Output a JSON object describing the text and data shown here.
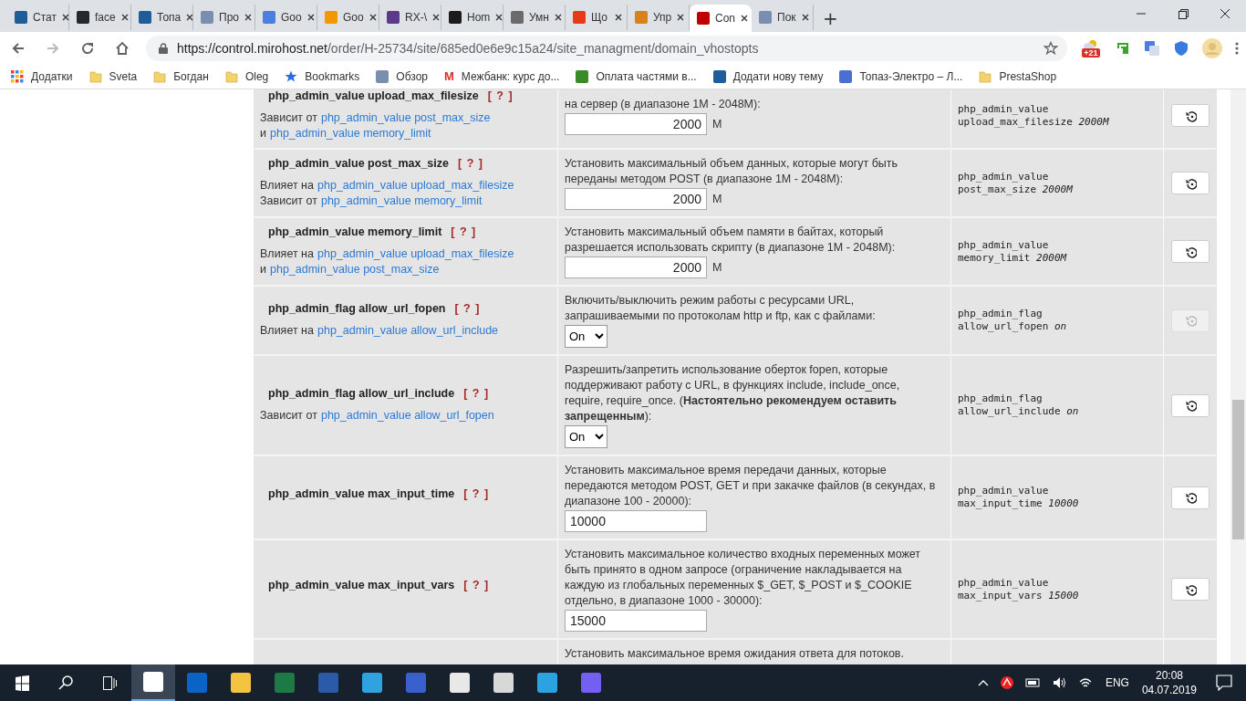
{
  "browser": {
    "tabs": [
      {
        "title": "Стат",
        "color": "#1f5c99",
        "selected": false
      },
      {
        "title": "face",
        "color": "#24292e",
        "selected": false
      },
      {
        "title": "Топа",
        "color": "#1f5c99",
        "selected": false
      },
      {
        "title": "Про",
        "color": "#7a8fb0",
        "selected": false
      },
      {
        "title": "Goo",
        "color": "#4a7fe0",
        "selected": false
      },
      {
        "title": "Goo",
        "color": "#f29900",
        "selected": false
      },
      {
        "title": "RX-\\",
        "color": "#5b3a8a",
        "selected": false
      },
      {
        "title": "Hom",
        "color": "#1b1b1b",
        "selected": false
      },
      {
        "title": "Умн",
        "color": "#6b6b6b",
        "selected": false
      },
      {
        "title": "Що",
        "color": "#e8391b",
        "selected": false
      },
      {
        "title": "Упр",
        "color": "#d9821b",
        "selected": false
      },
      {
        "title": "Con",
        "color": "#c00000",
        "selected": true
      },
      {
        "title": "Пок",
        "color": "#7a8fb0",
        "selected": false
      }
    ],
    "new_tab": "+",
    "url_host": "https://control.mirohost.net",
    "url_path": "/order/H-25734/site/685ed0e6e9c15a24/site_managment/domain_vhostopts",
    "extension_badge": "+21",
    "bookmarks": [
      {
        "kind": "grid",
        "label": "Додатки"
      },
      {
        "kind": "folder",
        "label": "Sveta"
      },
      {
        "kind": "folder",
        "label": "Богдан"
      },
      {
        "kind": "folder",
        "label": "Oleg"
      },
      {
        "kind": "star",
        "label": "Bookmarks"
      },
      {
        "kind": "site",
        "label": "Обзор",
        "color": "#7a8fb0"
      },
      {
        "kind": "letter",
        "label": "Межбанк: курс до...",
        "icon": "M"
      },
      {
        "kind": "site",
        "label": "Оплата частями в...",
        "color": "#3a8a2a"
      },
      {
        "kind": "site",
        "label": "Додати нову тему",
        "color": "#1f5c99"
      },
      {
        "kind": "site",
        "label": "Топаз-Электро – Л...",
        "color": "#4a6fd0"
      },
      {
        "kind": "folder",
        "label": "PrestaShop"
      }
    ]
  },
  "settings": [
    {
      "name": "php_admin_value upload_max_filesize",
      "help": "[ ? ]",
      "relations": [
        {
          "label": "Зависит от",
          "link": "php_admin_value post_max_size"
        },
        {
          "label": "и",
          "link": "php_admin_value memory_limit"
        }
      ],
      "description": "на сервер (в диапазоне 1M - 2048M):",
      "control": {
        "kind": "number",
        "value": "2000",
        "unit": "M"
      },
      "current_name": "php_admin_value upload_max_filesize",
      "current_value": "2000M",
      "reset_disabled": false
    },
    {
      "name": "php_admin_value post_max_size",
      "help": "[ ? ]",
      "relations": [
        {
          "label": "Влияет на",
          "link": "php_admin_value upload_max_filesize"
        },
        {
          "label": "Зависит от",
          "link": "php_admin_value memory_limit"
        }
      ],
      "description": "Установить максимальный объем данных, которые могут быть переданы методом POST (в диапазоне 1M - 2048M):",
      "control": {
        "kind": "number",
        "value": "2000",
        "unit": "M"
      },
      "current_name": "php_admin_value post_max_size",
      "current_value": "2000M",
      "reset_disabled": false
    },
    {
      "name": "php_admin_value memory_limit",
      "help": "[ ? ]",
      "relations": [
        {
          "label": "Влияет на",
          "link": "php_admin_value upload_max_filesize"
        },
        {
          "label": "и",
          "link": "php_admin_value post_max_size"
        }
      ],
      "description": "Установить максимальный объем памяти в байтах, который разрешается использовать скрипту (в диапазоне 1M - 2048M):",
      "control": {
        "kind": "number",
        "value": "2000",
        "unit": "M"
      },
      "current_name": "php_admin_value memory_limit",
      "current_value": "2000M",
      "reset_disabled": false
    },
    {
      "name": "php_admin_flag allow_url_fopen",
      "help": "[ ? ]",
      "relations": [
        {
          "label": "Влияет на",
          "link": "php_admin_value allow_url_include"
        }
      ],
      "description": "Включить/выключить режим работы с ресурсами URL, запрашиваемыми по протоколам http и ftp, как с файлами:",
      "control": {
        "kind": "select",
        "value": "On"
      },
      "current_name": "php_admin_flag allow_url_fopen",
      "current_value": "on",
      "reset_disabled": true
    },
    {
      "name": "php_admin_flag allow_url_include",
      "help": "[ ? ]",
      "relations": [
        {
          "label": "Зависит от",
          "link": "php_admin_value allow_url_fopen"
        }
      ],
      "description": "Разрешить/запретить использование оберток fopen, которые поддерживают работу с URL, в функциях include, include_once, require, require_once. (**Настоятельно рекомендуем оставить запрещенным**):",
      "control": {
        "kind": "select",
        "value": "On"
      },
      "current_name": "php_admin_flag allow_url_include",
      "current_value": "on",
      "reset_disabled": false
    },
    {
      "name": "php_admin_value max_input_time",
      "help": "[ ? ]",
      "description": "Установить максимальное время передачи данных, которые передаются методом POST, GET и при закачке файлов (в секундах, в диапазоне 100 - 20000):",
      "control": {
        "kind": "text",
        "value": "10000"
      },
      "current_name": "php_admin_value max_input_time",
      "current_value": "10000",
      "reset_disabled": false
    },
    {
      "name": "php_admin_value max_input_vars",
      "help": "[ ? ]",
      "description": "Установить максимальное количество входных переменных может быть принято в одном запросе (ограничение накладывается на каждую из глобальных переменных $_GET, $_POST и $_COOKIE отдельно, в диапазоне 1000 - 30000):",
      "control": {
        "kind": "text",
        "value": "15000"
      },
      "current_name": "php_admin_value max_input_vars",
      "current_value": "15000",
      "reset_disabled": false
    },
    {
      "description": "Установить максимальное время ожидания ответа для потоков."
    }
  ],
  "taskbar": {
    "apps": [
      {
        "kind": "app",
        "color": "#ffffff",
        "selected": true
      },
      {
        "kind": "app",
        "color": "#0a64c8",
        "selected": false
      },
      {
        "kind": "app",
        "color": "#f5c342",
        "selected": false
      },
      {
        "kind": "app",
        "color": "#1d7a45",
        "selected": false
      },
      {
        "kind": "app",
        "color": "#2b5aa8",
        "selected": false
      },
      {
        "kind": "app",
        "color": "#2fa3e0",
        "selected": false
      },
      {
        "kind": "app",
        "color": "#3a60d0",
        "selected": false
      },
      {
        "kind": "app",
        "color": "#e8e8e8",
        "selected": false
      },
      {
        "kind": "app",
        "color": "#d8d8d8",
        "selected": false
      },
      {
        "kind": "app",
        "color": "#2aa3e0",
        "selected": false
      },
      {
        "kind": "app",
        "color": "#7360f2",
        "selected": false
      }
    ],
    "language": "ENG",
    "time": "20:08",
    "date": "04.07.2019"
  }
}
